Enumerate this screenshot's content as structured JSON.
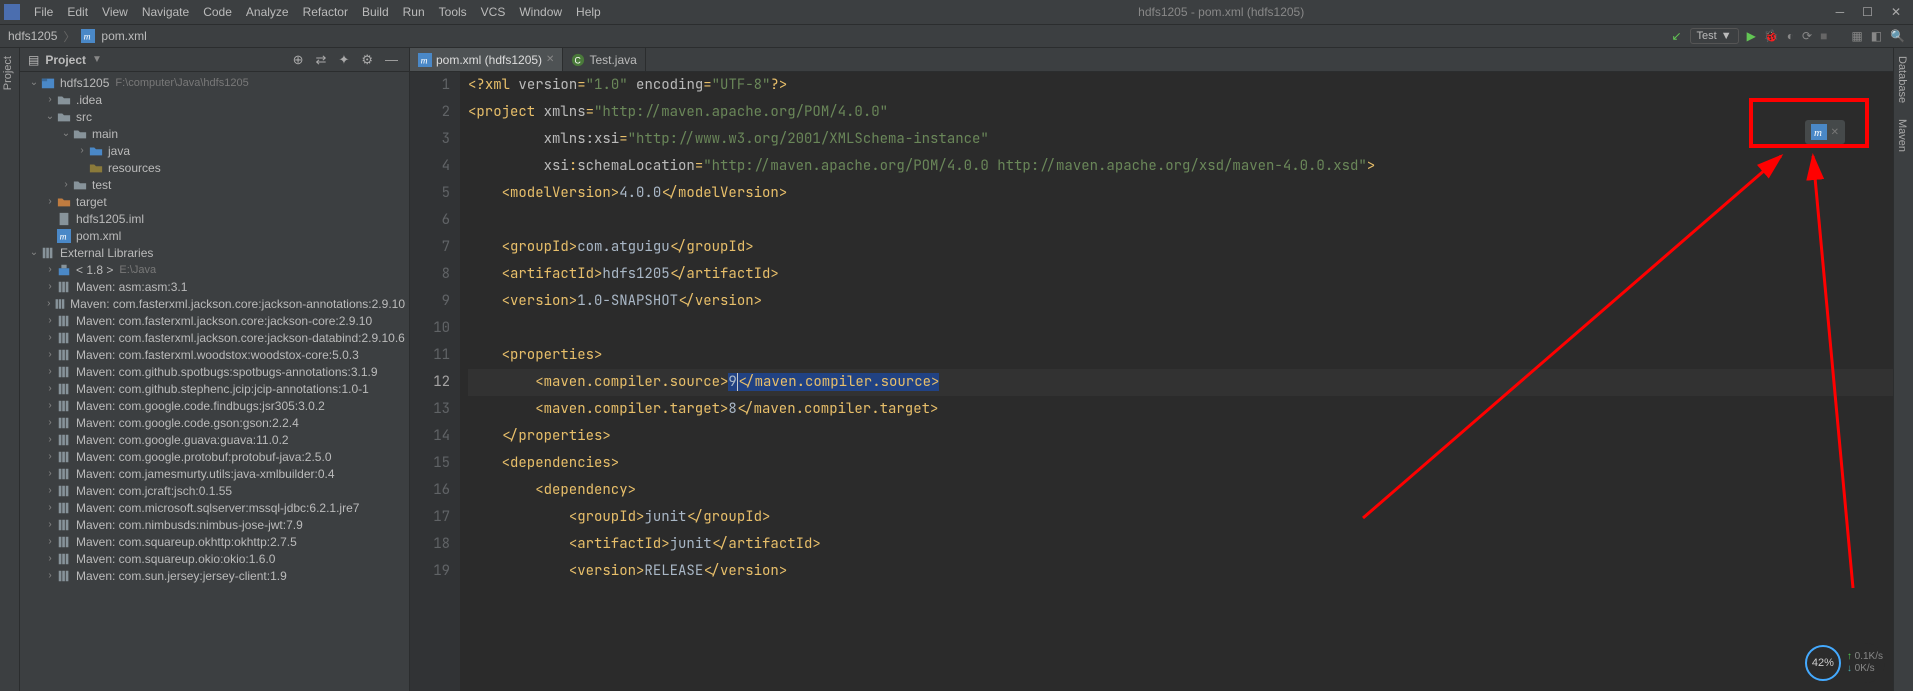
{
  "window": {
    "title": "hdfs1205 - pom.xml (hdfs1205)"
  },
  "menu": [
    "File",
    "Edit",
    "View",
    "Navigate",
    "Code",
    "Analyze",
    "Refactor",
    "Build",
    "Run",
    "Tools",
    "VCS",
    "Window",
    "Help"
  ],
  "breadcrumb": {
    "project": "hdfs1205",
    "file": "pom.xml"
  },
  "run_config": "Test",
  "sidebar": {
    "title": "Project",
    "nodes": [
      {
        "depth": 0,
        "arrow": "down",
        "icon": "module",
        "label": "hdfs1205",
        "suffix": "F:\\computer\\Java\\hdfs1205"
      },
      {
        "depth": 1,
        "arrow": "right",
        "icon": "folder",
        "label": ".idea"
      },
      {
        "depth": 1,
        "arrow": "down",
        "icon": "folder",
        "label": "src"
      },
      {
        "depth": 2,
        "arrow": "down",
        "icon": "folder",
        "label": "main"
      },
      {
        "depth": 3,
        "arrow": "right",
        "icon": "folder-blue",
        "label": "java"
      },
      {
        "depth": 3,
        "arrow": "",
        "icon": "folder-res",
        "label": "resources"
      },
      {
        "depth": 2,
        "arrow": "right",
        "icon": "folder",
        "label": "test"
      },
      {
        "depth": 1,
        "arrow": "right",
        "icon": "folder-orange",
        "label": "target"
      },
      {
        "depth": 1,
        "arrow": "",
        "icon": "file",
        "label": "hdfs1205.iml"
      },
      {
        "depth": 1,
        "arrow": "",
        "icon": "maven",
        "label": "pom.xml"
      },
      {
        "depth": 0,
        "arrow": "down",
        "icon": "lib",
        "label": "External Libraries"
      },
      {
        "depth": 1,
        "arrow": "right",
        "icon": "jdk",
        "label": "< 1.8 >",
        "suffix": "E:\\Java"
      },
      {
        "depth": 1,
        "arrow": "right",
        "icon": "lib",
        "label": "Maven: asm:asm:3.1"
      },
      {
        "depth": 1,
        "arrow": "right",
        "icon": "lib",
        "label": "Maven: com.fasterxml.jackson.core:jackson-annotations:2.9.10"
      },
      {
        "depth": 1,
        "arrow": "right",
        "icon": "lib",
        "label": "Maven: com.fasterxml.jackson.core:jackson-core:2.9.10"
      },
      {
        "depth": 1,
        "arrow": "right",
        "icon": "lib",
        "label": "Maven: com.fasterxml.jackson.core:jackson-databind:2.9.10.6"
      },
      {
        "depth": 1,
        "arrow": "right",
        "icon": "lib",
        "label": "Maven: com.fasterxml.woodstox:woodstox-core:5.0.3"
      },
      {
        "depth": 1,
        "arrow": "right",
        "icon": "lib",
        "label": "Maven: com.github.spotbugs:spotbugs-annotations:3.1.9"
      },
      {
        "depth": 1,
        "arrow": "right",
        "icon": "lib",
        "label": "Maven: com.github.stephenc.jcip:jcip-annotations:1.0-1"
      },
      {
        "depth": 1,
        "arrow": "right",
        "icon": "lib",
        "label": "Maven: com.google.code.findbugs:jsr305:3.0.2"
      },
      {
        "depth": 1,
        "arrow": "right",
        "icon": "lib",
        "label": "Maven: com.google.code.gson:gson:2.2.4"
      },
      {
        "depth": 1,
        "arrow": "right",
        "icon": "lib",
        "label": "Maven: com.google.guava:guava:11.0.2"
      },
      {
        "depth": 1,
        "arrow": "right",
        "icon": "lib",
        "label": "Maven: com.google.protobuf:protobuf-java:2.5.0"
      },
      {
        "depth": 1,
        "arrow": "right",
        "icon": "lib",
        "label": "Maven: com.jamesmurty.utils:java-xmlbuilder:0.4"
      },
      {
        "depth": 1,
        "arrow": "right",
        "icon": "lib",
        "label": "Maven: com.jcraft:jsch:0.1.55"
      },
      {
        "depth": 1,
        "arrow": "right",
        "icon": "lib",
        "label": "Maven: com.microsoft.sqlserver:mssql-jdbc:6.2.1.jre7"
      },
      {
        "depth": 1,
        "arrow": "right",
        "icon": "lib",
        "label": "Maven: com.nimbusds:nimbus-jose-jwt:7.9"
      },
      {
        "depth": 1,
        "arrow": "right",
        "icon": "lib",
        "label": "Maven: com.squareup.okhttp:okhttp:2.7.5"
      },
      {
        "depth": 1,
        "arrow": "right",
        "icon": "lib",
        "label": "Maven: com.squareup.okio:okio:1.6.0"
      },
      {
        "depth": 1,
        "arrow": "right",
        "icon": "lib",
        "label": "Maven: com.sun.jersey:jersey-client:1.9"
      }
    ]
  },
  "tabs": [
    {
      "icon": "maven",
      "label": "pom.xml (hdfs1205)",
      "active": true
    },
    {
      "icon": "java",
      "label": "Test.java",
      "active": false
    }
  ],
  "code_lines": 19,
  "netwidget": {
    "percent": "42%",
    "up": "0.1K/s",
    "down": "0K/s"
  },
  "right_tools": [
    "Database",
    "Maven"
  ],
  "left_tool": "Project"
}
